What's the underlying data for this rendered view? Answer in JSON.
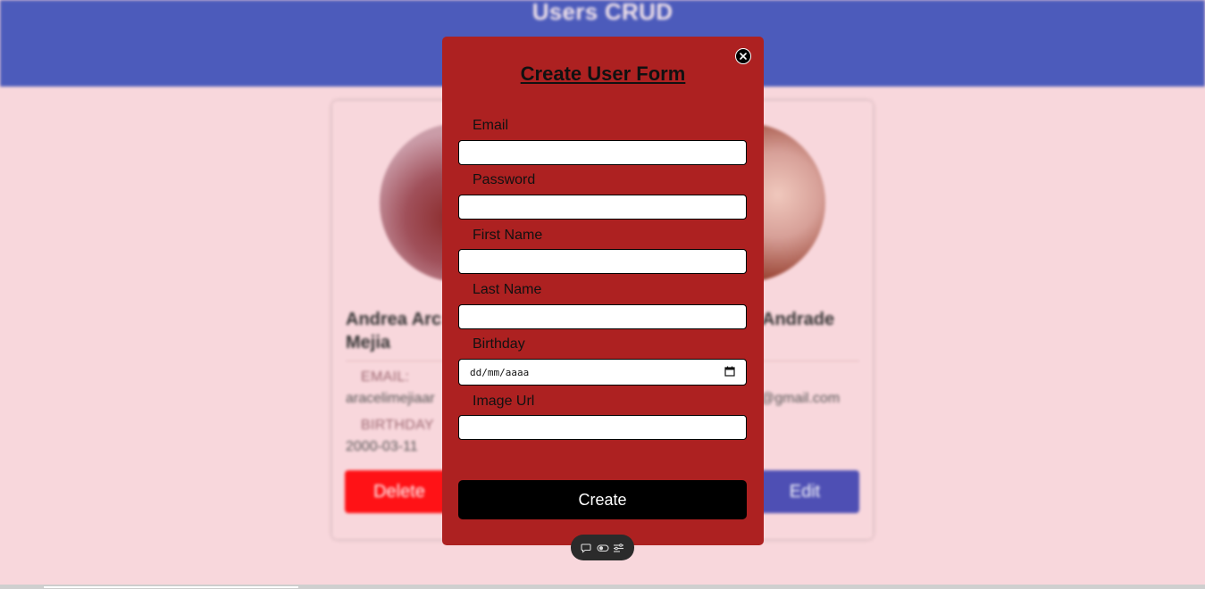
{
  "app": {
    "title": "Users CRUD"
  },
  "cards": [
    {
      "name": "Andrea Arc\nMejia",
      "email_label": "EMAIL:",
      "email_value": "aracelimejiaar",
      "birthday_label": "BIRTHDAY",
      "birthday_value": "2000-03-11",
      "button_label": "Delete"
    },
    {
      "name": "Andrade",
      "email_value": "@gmail.com",
      "button_label": "Edit"
    }
  ],
  "modal": {
    "title": "Create User Form",
    "fields": [
      {
        "label": "Email",
        "value": ""
      },
      {
        "label": "Password",
        "value": ""
      },
      {
        "label": "First Name",
        "value": ""
      },
      {
        "label": "Last Name",
        "value": ""
      },
      {
        "label": "Birthday",
        "placeholder": "dd/mm/aaaa"
      },
      {
        "label": "Image Url",
        "value": ""
      }
    ],
    "submit_label": "Create"
  },
  "icons": {
    "close": "close-icon",
    "toolbar": [
      "comment-icon",
      "toggle-icon",
      "settings-icon"
    ]
  },
  "colors": {
    "header": "#4c5bbb",
    "background": "#f8d7dc",
    "modal": "#ad2121",
    "delete": "#ff1216",
    "edit": "#4e4fb4"
  }
}
